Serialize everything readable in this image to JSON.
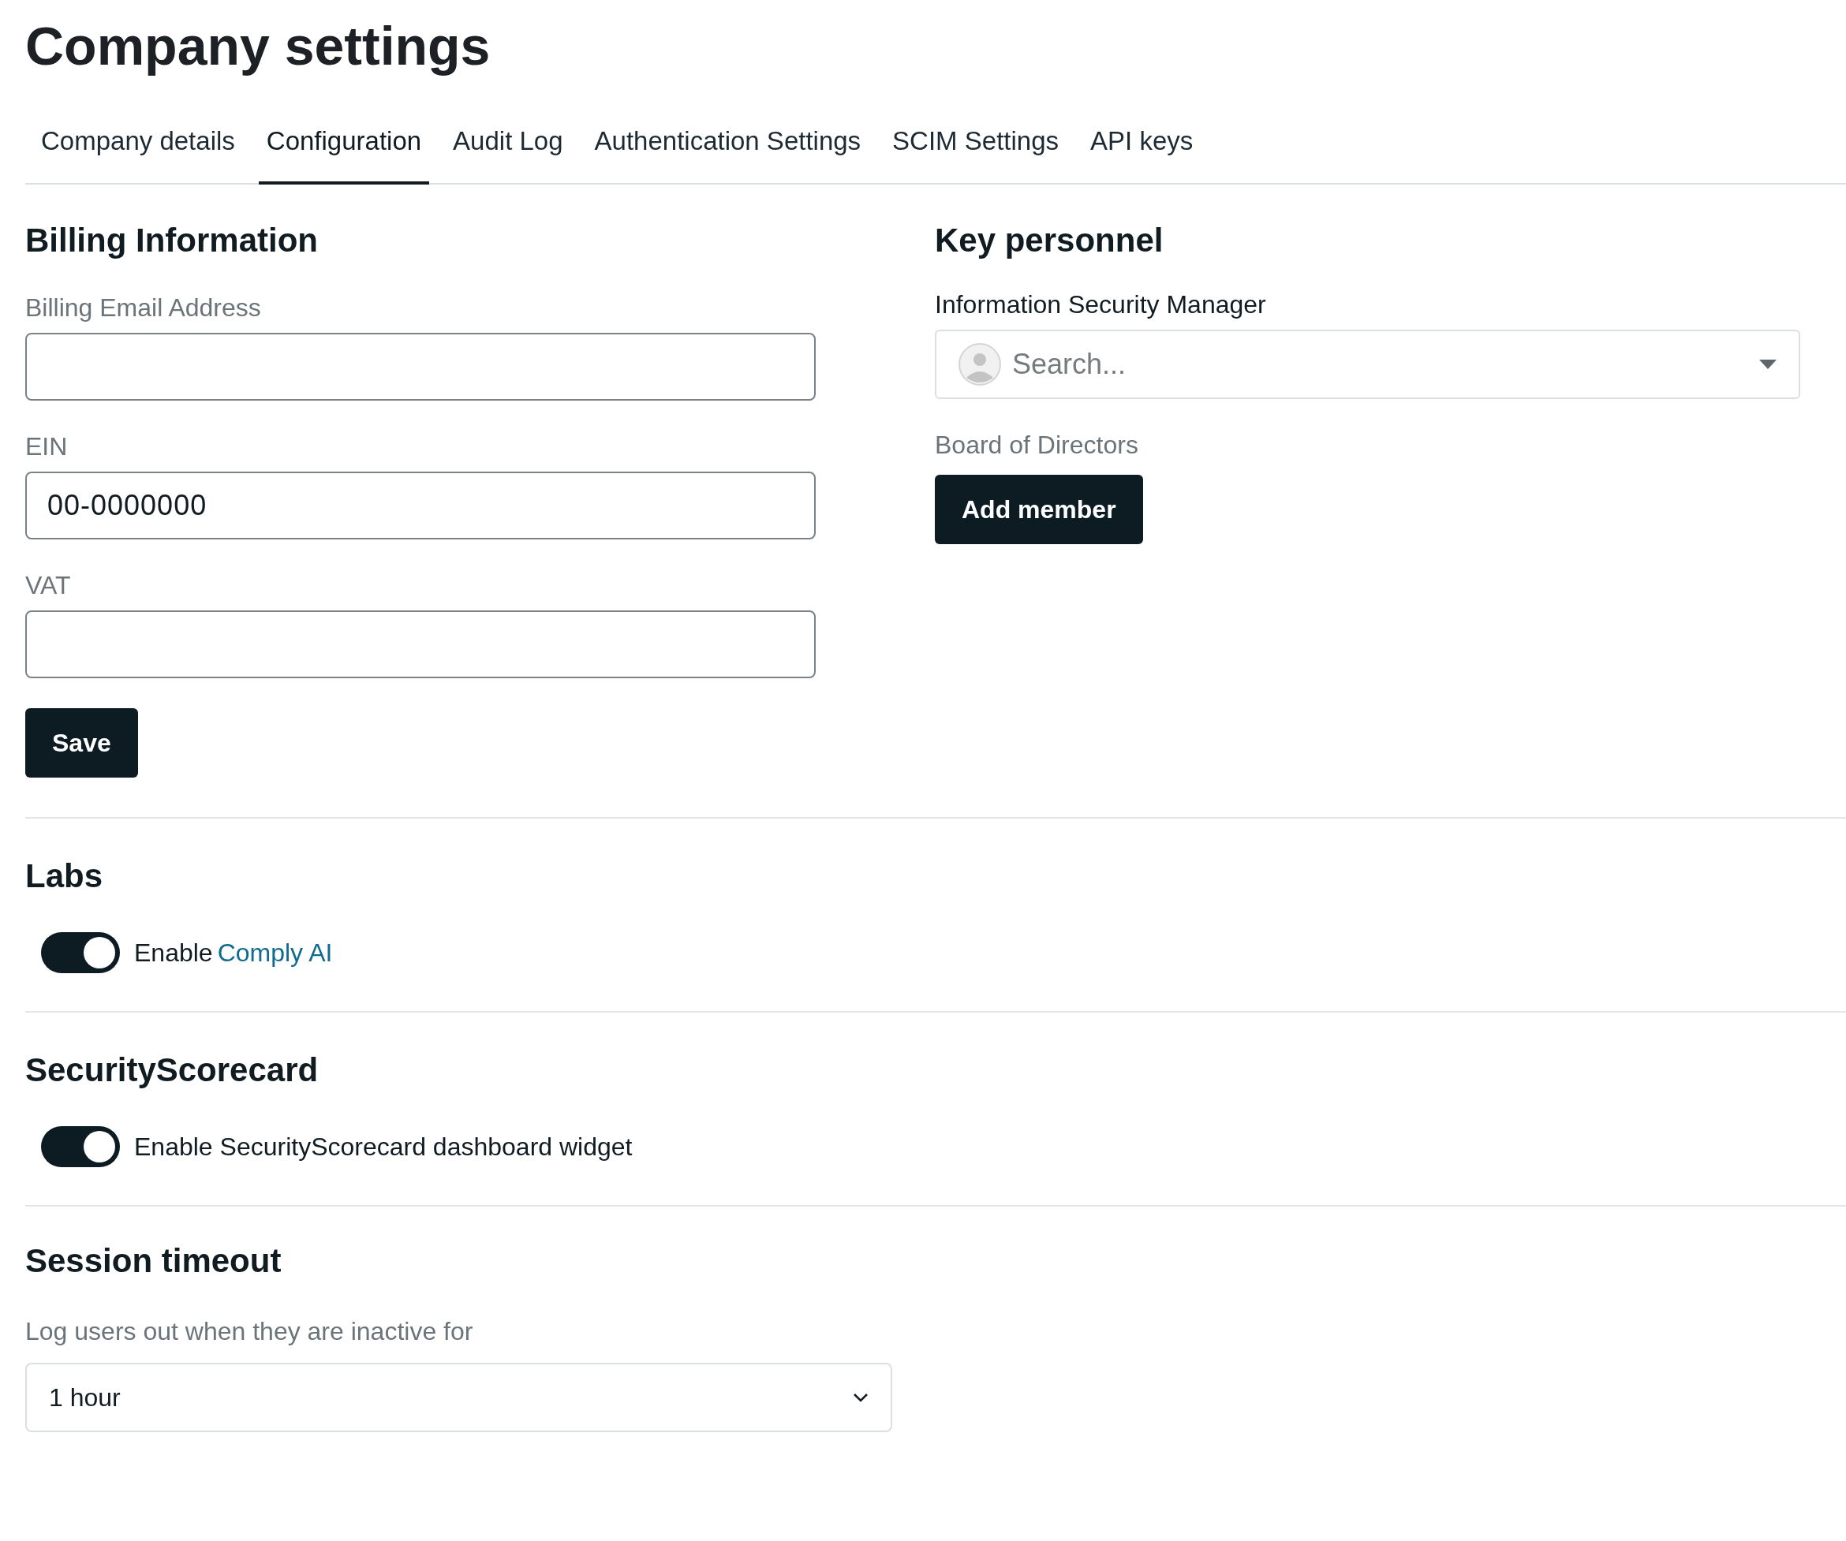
{
  "title": "Company settings",
  "tabs": [
    {
      "label": "Company details",
      "selected": false
    },
    {
      "label": "Configuration",
      "selected": true
    },
    {
      "label": "Audit Log",
      "selected": false
    },
    {
      "label": "Authentication Settings",
      "selected": false
    },
    {
      "label": "SCIM Settings",
      "selected": false
    },
    {
      "label": "API keys",
      "selected": false
    }
  ],
  "billing": {
    "heading": "Billing Information",
    "fields": [
      {
        "label": "Billing Email Address"
      },
      {
        "label": "EIN",
        "value": "00-0000000"
      },
      {
        "label": "VAT"
      }
    ],
    "button": "Save"
  },
  "key_personnel": {
    "heading": "Key personnel",
    "manager_label": "Information Security Manager",
    "manager_placeholder": "Search...",
    "board_label": "Board of Directors",
    "button": "Add member"
  },
  "labs": {
    "heading": "Labs",
    "toggles": [
      {
        "label": "Enable",
        "link": "Comply AI",
        "on": true
      }
    ]
  },
  "security_scorecard": {
    "heading": "SecurityScorecard",
    "toggles": [
      {
        "label": "Enable SecurityScorecard dashboard widget",
        "on": true
      }
    ]
  },
  "session_timeout": {
    "heading": "Session timeout",
    "label": "Log users out when they are inactive for",
    "value": "1 hour"
  }
}
